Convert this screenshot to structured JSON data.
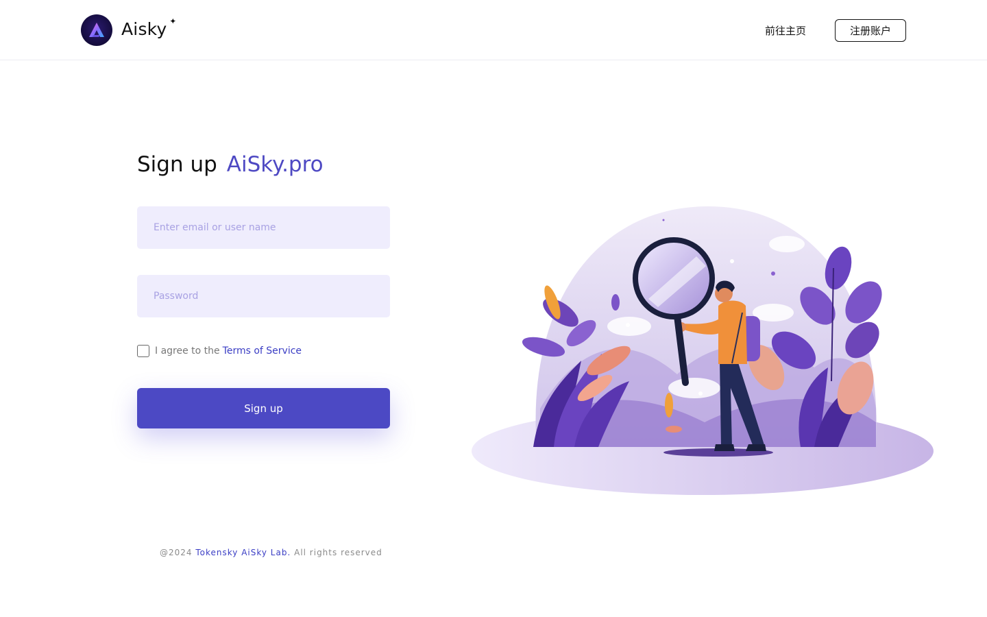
{
  "header": {
    "logo_text": "Aisky",
    "logo_star": "✦",
    "nav_home": "前往主页",
    "nav_register": "注册账户"
  },
  "form": {
    "title": "Sign up",
    "brand": "AiSky.pro",
    "email_placeholder": "Enter email or user name",
    "password_placeholder": "Password",
    "agree_text": "I agree to the",
    "terms_link": "Terms of Service",
    "submit_label": "Sign up"
  },
  "footer": {
    "prefix": "@2024",
    "link": "Tokensky AiSky Lab.",
    "suffix": "All rights reserved"
  },
  "illustration": {
    "subject": "person-with-magnifying-glass-illustration"
  },
  "colors": {
    "brand": "#4e49c3",
    "button": "#4c49c4",
    "input_bg": "#efedfd",
    "link": "#3a3dc4"
  }
}
